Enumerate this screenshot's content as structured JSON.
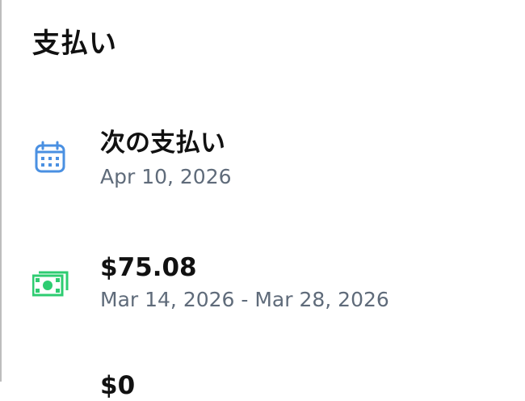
{
  "page": {
    "title": "支払い"
  },
  "payments": {
    "next": {
      "title": "次の支払い",
      "date": "Apr 10, 2026",
      "icon": "calendar-icon",
      "icon_color": "#4a90e2"
    },
    "amount": {
      "title": "$75.08",
      "period": "Mar 14, 2026 - Mar 28, 2026",
      "icon": "cash-icon",
      "icon_color": "#2ecc71"
    },
    "partial_next_row": {
      "title_fragment": "$0"
    }
  }
}
